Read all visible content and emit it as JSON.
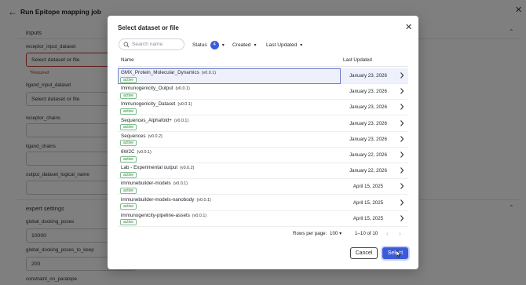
{
  "background": {
    "title": "Run Epitope mapping job",
    "inputs_section": "inputs",
    "fields": [
      {
        "label": "receptor_input_dataset",
        "value": "Select dataset or file",
        "error": "*Required"
      },
      {
        "label": "ligand_input_dataset",
        "value": "Select dataset or file"
      },
      {
        "label": "receptor_chains",
        "value": ""
      },
      {
        "label": "ligand_chains",
        "value": ""
      },
      {
        "label": "output_dataset_logical_name",
        "value": ""
      }
    ],
    "expert_section": "expert settings",
    "expert_fields": [
      {
        "label": "global_docking_poses",
        "value": "10000"
      },
      {
        "label": "global_docking_poses_to_keep",
        "value": "200"
      },
      {
        "label": "constraint_on_paratope",
        "value": ""
      }
    ]
  },
  "modal": {
    "title": "Select dataset or file",
    "search_placeholder": "Search name",
    "filters": {
      "status_label": "Status",
      "status_count": "4",
      "created_label": "Created",
      "last_updated_label": "Last Updated"
    },
    "columns": {
      "name": "Name",
      "last_updated": "Last Updated"
    },
    "rows": [
      {
        "name": "GMX_Protein_Molecular_Dynamics",
        "version": "(v0.0.1)",
        "status": "active",
        "date": "January 23, 2026"
      },
      {
        "name": "Immunogenicity_Output",
        "version": "(v0.0.1)",
        "status": "active",
        "date": "January 23, 2026"
      },
      {
        "name": "Immunogenicity_Dataset",
        "version": "(v0.0.1)",
        "status": "active",
        "date": "January 23, 2026"
      },
      {
        "name": "Sequences_Alphafold+",
        "version": "(v0.0.1)",
        "status": "active",
        "date": "January 23, 2026"
      },
      {
        "name": "Sequences",
        "version": "(v0.0.2)",
        "status": "active",
        "date": "January 23, 2026"
      },
      {
        "name": "6W2C",
        "version": "(v0.0.1)",
        "status": "active",
        "date": "January 22, 2026"
      },
      {
        "name": "Lab - Experimental output",
        "version": "(v0.0.2)",
        "status": "active",
        "date": "January 22, 2026"
      },
      {
        "name": "immunebuilder-models",
        "version": "(v0.0.1)",
        "status": "active",
        "date": "April 15, 2025"
      },
      {
        "name": "immunebuilder-models-nanobody",
        "version": "(v0.0.1)",
        "status": "active",
        "date": "April 15, 2025"
      },
      {
        "name": "immunogenicity-pipeline-assets",
        "version": "(v0.0.1)",
        "status": "active",
        "date": "April 15, 2025"
      }
    ],
    "pagination": {
      "rows_per_page_label": "Rows per page:",
      "rows_per_page_value": "100",
      "range": "1–10 of 10"
    },
    "buttons": {
      "cancel": "Cancel",
      "select": "Select"
    }
  },
  "colors": {
    "accent": "#3b5bdb",
    "active_badge": "#2e7d3e",
    "error": "#c0392b"
  }
}
